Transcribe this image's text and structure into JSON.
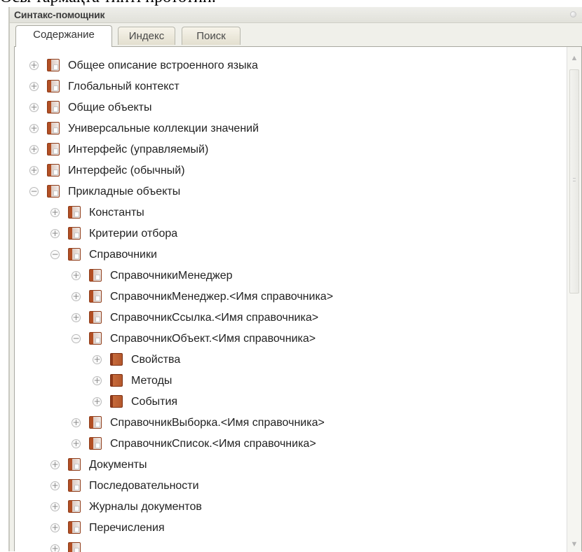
{
  "caption": "Осы тармақта типті прототип.",
  "window": {
    "title": "Синтакс-помощник"
  },
  "tabs": [
    {
      "label": "Содержание",
      "active": true
    },
    {
      "label": "Индекс",
      "active": false
    },
    {
      "label": "Поиск",
      "active": false
    }
  ],
  "tree": {
    "items": [
      {
        "label": "Общее описание встроенного языка",
        "level": 0,
        "state": "collapsed",
        "icon": "folder-book-icon"
      },
      {
        "label": "Глобальный контекст",
        "level": 0,
        "state": "collapsed",
        "icon": "folder-book-icon"
      },
      {
        "label": "Общие объекты",
        "level": 0,
        "state": "collapsed",
        "icon": "folder-book-icon"
      },
      {
        "label": "Универсальные коллекции значений",
        "level": 0,
        "state": "collapsed",
        "icon": "folder-book-icon"
      },
      {
        "label": "Интерфейс (управляемый)",
        "level": 0,
        "state": "collapsed",
        "icon": "folder-book-icon"
      },
      {
        "label": "Интерфейс (обычный)",
        "level": 0,
        "state": "collapsed",
        "icon": "folder-book-icon"
      },
      {
        "label": "Прикладные объекты",
        "level": 0,
        "state": "expanded",
        "icon": "folder-book-icon"
      },
      {
        "label": "Константы",
        "level": 1,
        "state": "collapsed",
        "icon": "folder-book-icon"
      },
      {
        "label": "Критерии отбора",
        "level": 1,
        "state": "collapsed",
        "icon": "folder-book-icon"
      },
      {
        "label": "Справочники",
        "level": 1,
        "state": "expanded",
        "icon": "folder-book-icon"
      },
      {
        "label": "СправочникиМенеджер",
        "level": 2,
        "state": "collapsed",
        "icon": "folder-book-icon"
      },
      {
        "label": "СправочникМенеджер.<Имя справочника>",
        "level": 2,
        "state": "collapsed",
        "icon": "folder-book-icon"
      },
      {
        "label": "СправочникСсылка.<Имя справочника>",
        "level": 2,
        "state": "collapsed",
        "icon": "folder-book-icon"
      },
      {
        "label": "СправочникОбъект.<Имя справочника>",
        "level": 2,
        "state": "expanded",
        "icon": "folder-book-icon"
      },
      {
        "label": "Свойства",
        "level": 3,
        "state": "collapsed",
        "icon": "book-icon"
      },
      {
        "label": "Методы",
        "level": 3,
        "state": "collapsed",
        "icon": "book-icon"
      },
      {
        "label": "События",
        "level": 3,
        "state": "collapsed",
        "icon": "book-icon"
      },
      {
        "label": "СправочникВыборка.<Имя справочника>",
        "level": 2,
        "state": "collapsed",
        "icon": "folder-book-icon"
      },
      {
        "label": "СправочникСписок.<Имя справочника>",
        "level": 2,
        "state": "collapsed",
        "icon": "folder-book-icon"
      },
      {
        "label": "Документы",
        "level": 1,
        "state": "collapsed",
        "icon": "folder-book-icon"
      },
      {
        "label": "Последовательности",
        "level": 1,
        "state": "collapsed",
        "icon": "folder-book-icon"
      },
      {
        "label": "Журналы документов",
        "level": 1,
        "state": "collapsed",
        "icon": "folder-book-icon"
      },
      {
        "label": "Перечисления",
        "level": 1,
        "state": "collapsed",
        "icon": "folder-book-icon"
      },
      {
        "label": "",
        "level": 1,
        "state": "collapsed",
        "icon": "folder-book-icon"
      }
    ]
  },
  "colors": {
    "panel_bg": "#f0f0ea",
    "book_brown": "#b24f24"
  }
}
